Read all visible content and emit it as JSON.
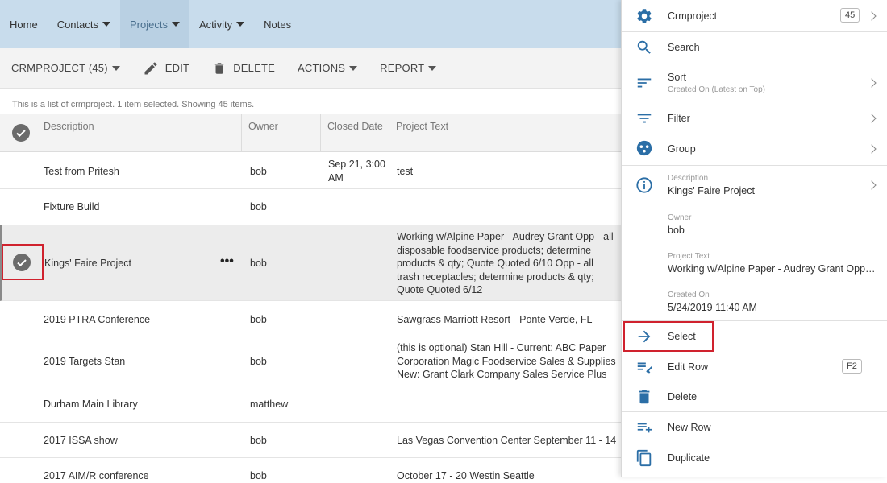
{
  "nav": {
    "items": [
      {
        "label": "Home",
        "has_caret": false,
        "active": false
      },
      {
        "label": "Contacts",
        "has_caret": true,
        "active": false
      },
      {
        "label": "Projects",
        "has_caret": true,
        "active": true
      },
      {
        "label": "Activity",
        "has_caret": true,
        "active": false
      },
      {
        "label": "Notes",
        "has_caret": false,
        "active": false
      }
    ]
  },
  "toolbar": {
    "collection_label": "CRMPROJECT (45)",
    "edit_label": "EDIT",
    "delete_label": "DELETE",
    "actions_label": "ACTIONS",
    "report_label": "REPORT"
  },
  "info_text": "This is a list of crmproject. 1 item selected. Showing 45 items.",
  "table": {
    "columns": [
      "Description",
      "Owner",
      "Closed Date",
      "Project Text"
    ],
    "rows": [
      {
        "description": "Test from Pritesh",
        "owner": "bob",
        "closed_line1": "Sep 21, 3:00",
        "closed_line2": "AM",
        "text_lines": [
          "test"
        ]
      },
      {
        "description": "Fixture Build",
        "owner": "bob",
        "closed_line1": "",
        "closed_line2": "",
        "text_lines": []
      },
      {
        "description": "Kings' Faire Project",
        "owner": "bob",
        "closed_line1": "",
        "closed_line2": "",
        "selected": true,
        "text_lines": [
          "Working w/Alpine Paper - Audrey Grant Opp - all",
          "disposable foodservice products; determine",
          "products & qty; Quote Quoted 6/10 Opp - all",
          "trash receptacles; determine products & qty;",
          "Quote Quoted 6/12"
        ]
      },
      {
        "description": "2019 PTRA Conference",
        "owner": "bob",
        "closed_line1": "",
        "closed_line2": "",
        "text_lines": [
          "Sawgrass Marriott Resort - Ponte Verde, FL"
        ]
      },
      {
        "description": "2019 Targets Stan",
        "owner": "bob",
        "closed_line1": "",
        "closed_line2": "",
        "text_lines": [
          "(this is optional) Stan Hill - Current: ABC Paper",
          "Corporation Magic Foodservice Sales & Supplies",
          "New: Grant Clark Company Sales Service Plus"
        ]
      },
      {
        "description": "Durham Main Library",
        "owner": "matthew",
        "closed_line1": "",
        "closed_line2": "",
        "text_lines": []
      },
      {
        "description": "2017 ISSA show",
        "owner": "bob",
        "closed_line1": "",
        "closed_line2": "",
        "text_lines": [
          "Las Vegas Convention Center September 11 - 14"
        ]
      },
      {
        "description": "2017 AIM/R conference",
        "owner": "bob",
        "closed_line1": "",
        "closed_line2": "",
        "text_lines": [
          "October 17 - 20 Westin Seattle"
        ]
      }
    ]
  },
  "panel": {
    "entity_label": "Crmproject",
    "entity_count": "45",
    "search_label": "Search",
    "sort_label": "Sort",
    "sort_sub": "Created On (Latest on Top)",
    "filter_label": "Filter",
    "group_label": "Group",
    "details": {
      "description_label": "Description",
      "description_value": "Kings' Faire Project",
      "owner_label": "Owner",
      "owner_value": "bob",
      "project_text_label": "Project Text",
      "project_text_value": "Working w/Alpine Paper - Audrey Grant Opp - all disposable foodservice products",
      "created_on_label": "Created On",
      "created_on_value": "5/24/2019 11:40 AM"
    },
    "select_label": "Select",
    "edit_row_label": "Edit Row",
    "edit_row_shortcut": "F2",
    "delete_label": "Delete",
    "new_row_label": "New Row",
    "duplicate_label": "Duplicate",
    "icon_color": "#2b6ea6"
  },
  "highlight_color": "#d0222e"
}
